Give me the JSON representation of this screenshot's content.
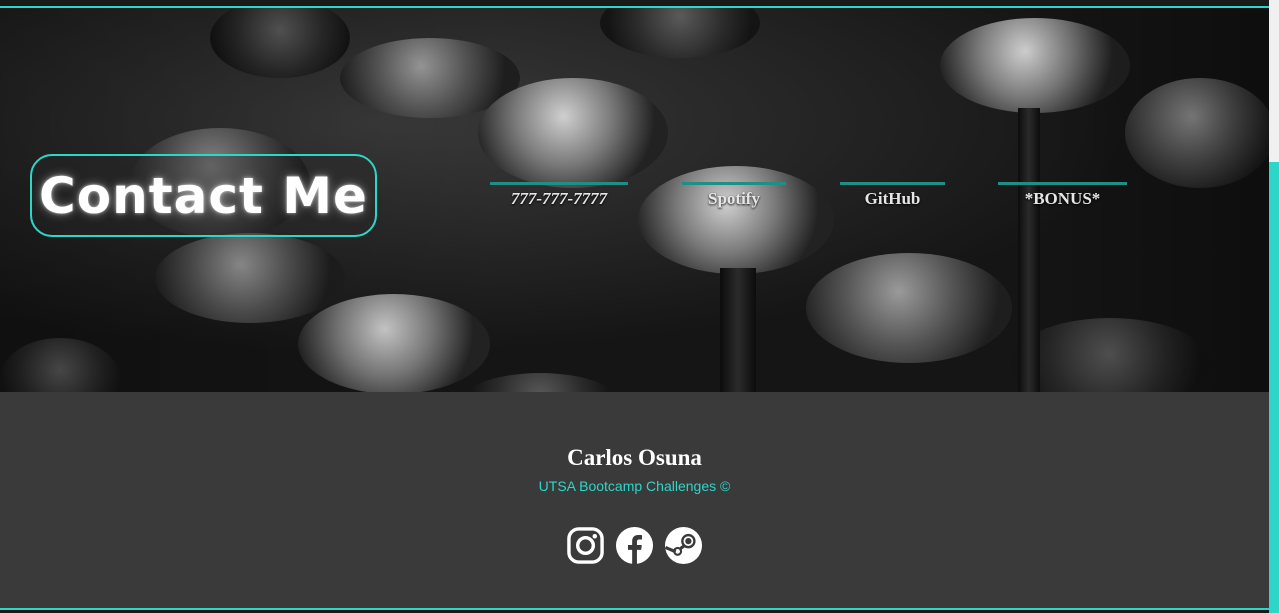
{
  "hero": {
    "title": "Contact Me",
    "links": [
      {
        "label": "777-777-7777"
      },
      {
        "label": "Spotify"
      },
      {
        "label": "GitHub"
      },
      {
        "label": "*BONUS*"
      }
    ]
  },
  "footer": {
    "name": "Carlos Osuna",
    "subtitle": "UTSA Bootcamp Challenges ©",
    "social": [
      {
        "icon": "instagram-icon"
      },
      {
        "icon": "facebook-icon"
      },
      {
        "icon": "steam-icon"
      }
    ]
  },
  "colors": {
    "accent": "#2dd6c8",
    "footer_bg": "#3a3a3a",
    "nav_underline": "#1e8f87"
  }
}
